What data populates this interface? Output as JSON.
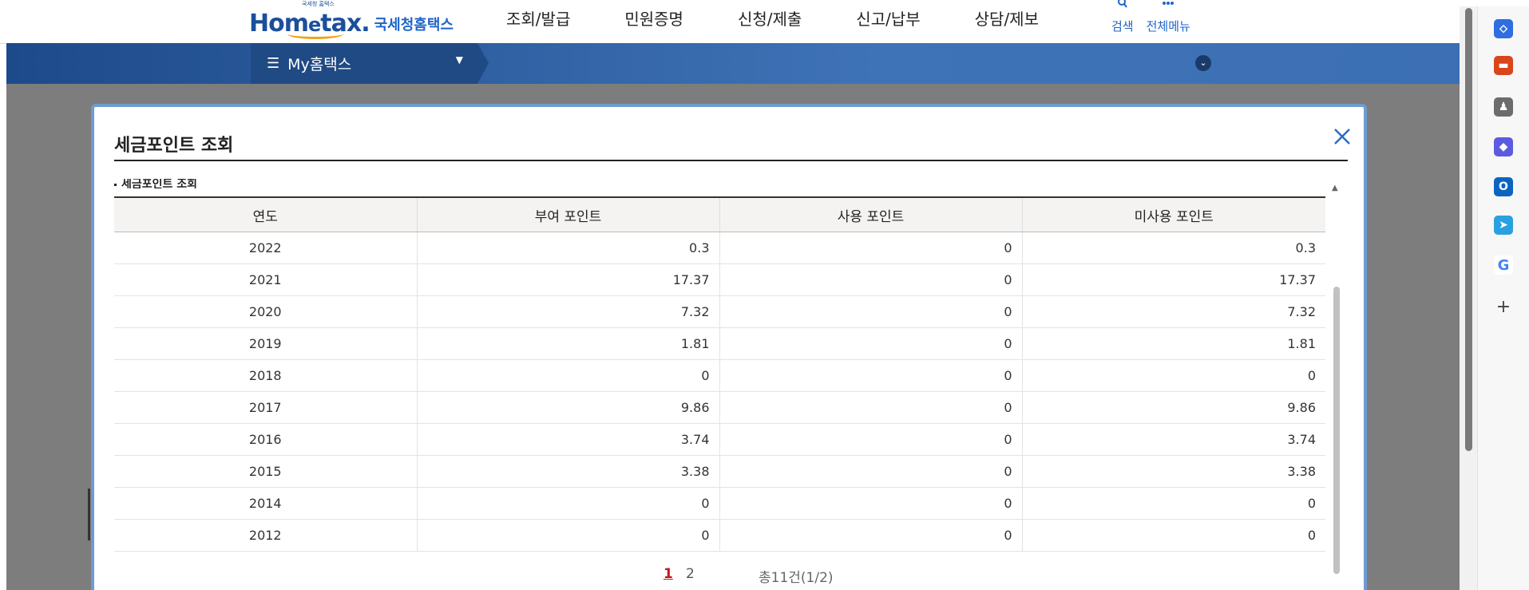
{
  "header": {
    "logo_tagline": "국세청 홈택스",
    "logo_brand": "Hom",
    "logo_brand_e": "e",
    "logo_brand_tail": "tax.",
    "logo_sub": "국세청홈택스",
    "nav": [
      "조회/발급",
      "민원증명",
      "신청/제출",
      "신고/납부",
      "상담/제보"
    ],
    "util": {
      "search": "검색",
      "all_menu": "전체메뉴"
    }
  },
  "menubar": {
    "mytax_label": "My홈택스"
  },
  "modal": {
    "title": "세금포인트 조회",
    "section_label": "세금포인트 조회",
    "table": {
      "headers": [
        "연도",
        "부여 포인트",
        "사용 포인트",
        "미사용 포인트"
      ],
      "rows": [
        [
          "2022",
          "0.3",
          "0",
          "0.3"
        ],
        [
          "2021",
          "17.37",
          "0",
          "17.37"
        ],
        [
          "2020",
          "7.32",
          "0",
          "7.32"
        ],
        [
          "2019",
          "1.81",
          "0",
          "1.81"
        ],
        [
          "2018",
          "0",
          "0",
          "0"
        ],
        [
          "2017",
          "9.86",
          "0",
          "9.86"
        ],
        [
          "2016",
          "3.74",
          "0",
          "3.74"
        ],
        [
          "2015",
          "3.38",
          "0",
          "3.38"
        ],
        [
          "2014",
          "0",
          "0",
          "0"
        ],
        [
          "2012",
          "0",
          "0",
          "0"
        ]
      ]
    },
    "pagination": {
      "pages": [
        "1",
        "2"
      ],
      "current": "1",
      "total": "총11건(1/2)"
    }
  },
  "colors": {
    "accent": "#1e64c8",
    "menubar": "#1f4a83",
    "active_page": "#c4161c"
  },
  "sidebar_icons": [
    "tag-icon",
    "briefcase-icon",
    "chess-icon",
    "copilot-icon",
    "outlook-icon",
    "send-icon",
    "google-icon",
    "add-icon"
  ]
}
